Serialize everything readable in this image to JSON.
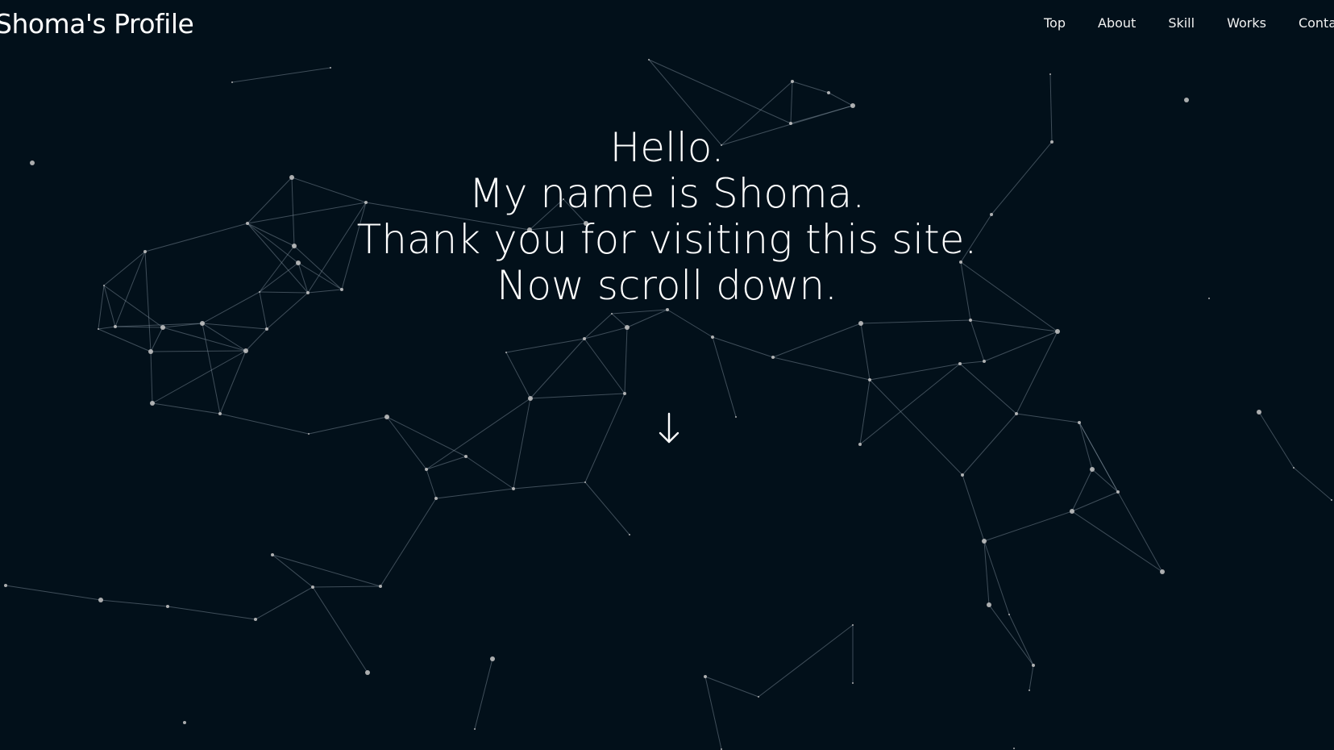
{
  "header": {
    "site_title": "Shoma's Profile"
  },
  "nav": {
    "items": [
      {
        "label": "Top"
      },
      {
        "label": "About"
      },
      {
        "label": "Skill"
      },
      {
        "label": "Works"
      },
      {
        "label": "Contact"
      }
    ]
  },
  "hero": {
    "lines": [
      "Hello.",
      "My name is Shoma.",
      "Thank you for visiting this site.",
      "Now scroll down."
    ]
  },
  "icons": {
    "scroll": "arrow-down-icon"
  },
  "colors": {
    "background": "#02101a",
    "text": "#ffffff",
    "particle": "#c8c8c8",
    "line": "#8a9aa6"
  }
}
